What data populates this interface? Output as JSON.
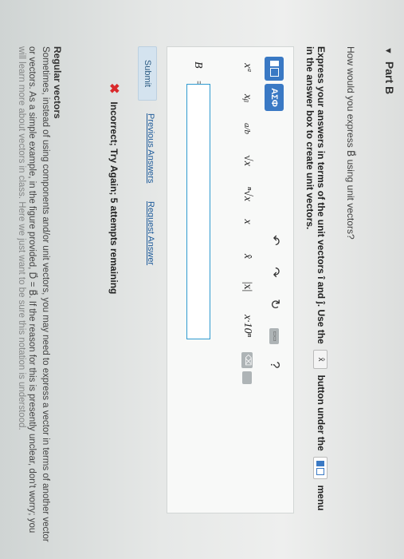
{
  "part": {
    "title": "Part B"
  },
  "question": {
    "text": "How would you express B⃗ using unit vectors?"
  },
  "instructions": {
    "line1_start": "Express your answers in terms of the unit vectors",
    "line1_mid": "î and ĵ. Use the",
    "inline_button_label": "x̂",
    "line1_end": "button under the",
    "line1_menu": "menu",
    "line2": "in the answer box to create unit vectors."
  },
  "toolbar": {
    "greek_label": "ΑΣΦ",
    "undo_icon": "undo-arrow-icon",
    "redo_icon": "redo-arrow-icon",
    "reset_icon": "reset-icon",
    "keyboard_label": "▭▭",
    "help_label": "?"
  },
  "symbols": {
    "superscript": "xᵃ",
    "subscript": "xᵦ",
    "fraction": "a/b",
    "sqrt": "√x",
    "nthroot": "ⁿ√x",
    "vector": "x⃗",
    "unitvec": "x̂",
    "abs": "|x|",
    "sci": "x·10ⁿ"
  },
  "answer": {
    "label": "B⃗ =",
    "value": ""
  },
  "actions": {
    "submit": "Submit",
    "previous": "Previous Answers",
    "request": "Request Answer"
  },
  "feedback": {
    "text": "Incorrect; Try Again; 5 attempts remaining"
  },
  "regular_vectors": {
    "title": "Regular vectors",
    "line1": "Sometimes, instead of using components and/or unit vectors, you may need to express a vector in terms of another vector",
    "line2": "or vectors. As a simple example, in the figure provided, D⃗ = B⃗. If the reason for this is presently unclear, don't worry; you",
    "line3": "will learn more about vectors in class. Here we just want to be sure this notation is understood."
  },
  "colors": {
    "accent": "#3a79c4",
    "error": "#d9292b",
    "link": "#1f5c9a",
    "input_border": "#2f9ad0"
  }
}
